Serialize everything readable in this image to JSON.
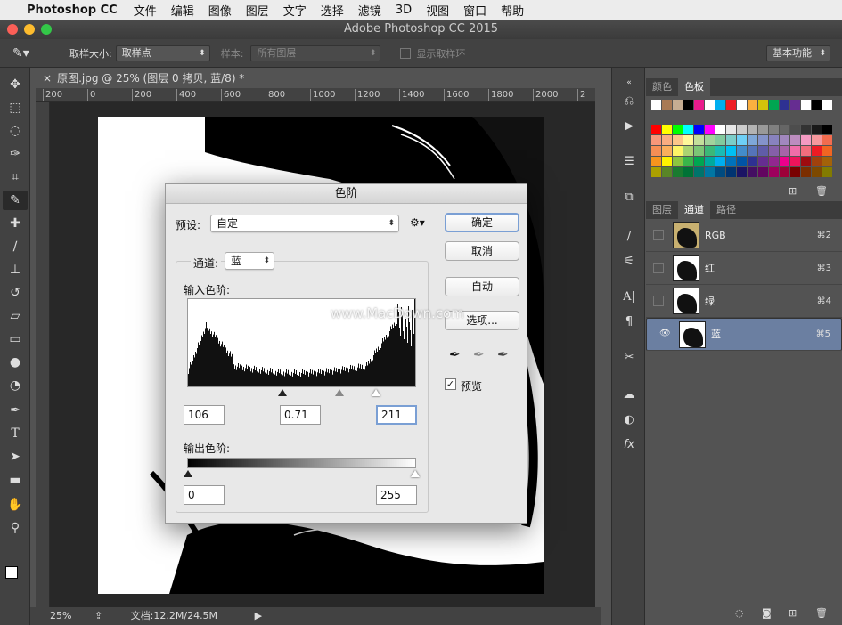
{
  "menubar": {
    "app": "Photoshop CC",
    "items": [
      "文件",
      "编辑",
      "图像",
      "图层",
      "文字",
      "选择",
      "滤镜",
      "3D",
      "视图",
      "窗口",
      "帮助"
    ]
  },
  "window": {
    "title": "Adobe Photoshop CC 2015"
  },
  "options": {
    "sample_size_label": "取样大小:",
    "sample_size_value": "取样点",
    "sample_label": "样本:",
    "sample_value": "所有图层",
    "show_ring": "显示取样环",
    "workspace": "基本功能"
  },
  "document": {
    "tab_title": "原图.jpg @ 25% (图层 0 拷贝, 蓝/8) *",
    "ruler_ticks": [
      "200",
      "0",
      "200",
      "400",
      "600",
      "800",
      "1000",
      "1200",
      "1400",
      "1600",
      "1800",
      "2000",
      "2"
    ]
  },
  "status": {
    "zoom": "25%",
    "doc_info": "文档:12.2M/24.5M"
  },
  "panels": {
    "color_tabs": [
      "颜色",
      "色板"
    ],
    "layer_tabs": [
      "图层",
      "通道",
      "路径"
    ],
    "channels": [
      {
        "name": "RGB",
        "shortcut": "⌘2"
      },
      {
        "name": "红",
        "shortcut": "⌘3"
      },
      {
        "name": "绿",
        "shortcut": "⌘4"
      },
      {
        "name": "蓝",
        "shortcut": "⌘5"
      }
    ]
  },
  "levels": {
    "title": "色阶",
    "preset_label": "预设:",
    "preset_value": "自定",
    "channel_label": "通道:",
    "channel_value": "蓝",
    "input_label": "输入色阶:",
    "output_label": "输出色阶:",
    "input_black": "106",
    "input_gamma": "0.71",
    "input_white": "211",
    "output_black": "0",
    "output_white": "255",
    "btn_ok": "确定",
    "btn_cancel": "取消",
    "btn_auto": "自动",
    "btn_options": "选项...",
    "preview_label": "预览",
    "watermark": "www.MacDown.com"
  },
  "colors": {
    "swatches": [
      "#ffffff",
      "#a87a55",
      "#c6ad92",
      "#000000",
      "#e91b8c",
      "#ffffff",
      "#00aeef",
      "#ed1c24",
      "#ffffff",
      "#fbb040",
      "#d4c20b",
      "#00a651",
      "#2e3192",
      "#662d91",
      "#ffffff",
      "#000000",
      "#ffffff"
    ]
  }
}
